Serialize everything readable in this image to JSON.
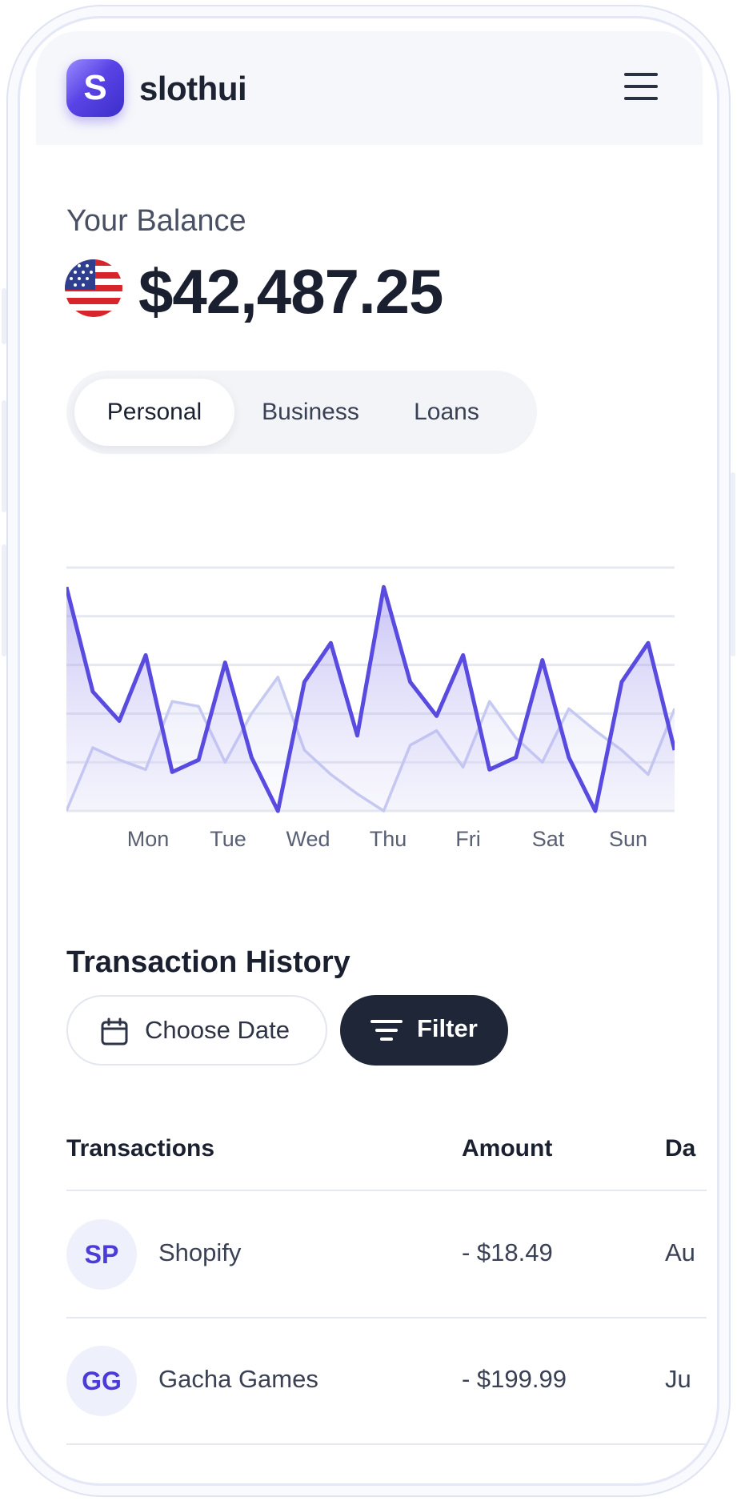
{
  "app": {
    "brand_initial": "S",
    "brand_name": "slothui",
    "menu_icon": "hamburger-menu-icon"
  },
  "balance": {
    "label": "Your Balance",
    "currency_flag": "us-flag-icon",
    "amount": "$42,487.25"
  },
  "account_tabs": [
    {
      "label": "Personal",
      "active": true
    },
    {
      "label": "Business",
      "active": false
    },
    {
      "label": "Loans",
      "active": false
    }
  ],
  "chart_data": {
    "type": "area",
    "title": "",
    "xlabel": "",
    "ylabel": "",
    "categories": [
      "Mon",
      "Tue",
      "Wed",
      "Thu",
      "Fri",
      "Sat",
      "Sun"
    ],
    "grid": true,
    "legend": "none",
    "ylim": [
      0,
      100
    ],
    "series": [
      {
        "color": "#5a4be0",
        "values": [
          92,
          49,
          37,
          64,
          16,
          21,
          61,
          22,
          0,
          53,
          69,
          31,
          92,
          53,
          39,
          64,
          17,
          22,
          62,
          22,
          0,
          53,
          69,
          25
        ]
      },
      {
        "color": "#c6c9f2",
        "values": [
          0,
          26,
          21,
          17,
          45,
          43,
          20,
          40,
          55,
          25,
          15,
          7,
          0,
          27,
          33,
          18,
          45,
          30,
          20,
          42,
          33,
          25,
          15,
          42
        ]
      }
    ]
  },
  "transactions": {
    "title": "Transaction History",
    "choose_date_label": "Choose Date",
    "filter_label": "Filter",
    "columns": {
      "name": "Transactions",
      "amount": "Amount",
      "date": "Da"
    },
    "rows": [
      {
        "initials": "SP",
        "name": "Shopify",
        "amount": "- $18.49",
        "date": "Au"
      },
      {
        "initials": "GG",
        "name": "Gacha Games",
        "amount": "- $199.99",
        "date": "Ju"
      }
    ]
  }
}
